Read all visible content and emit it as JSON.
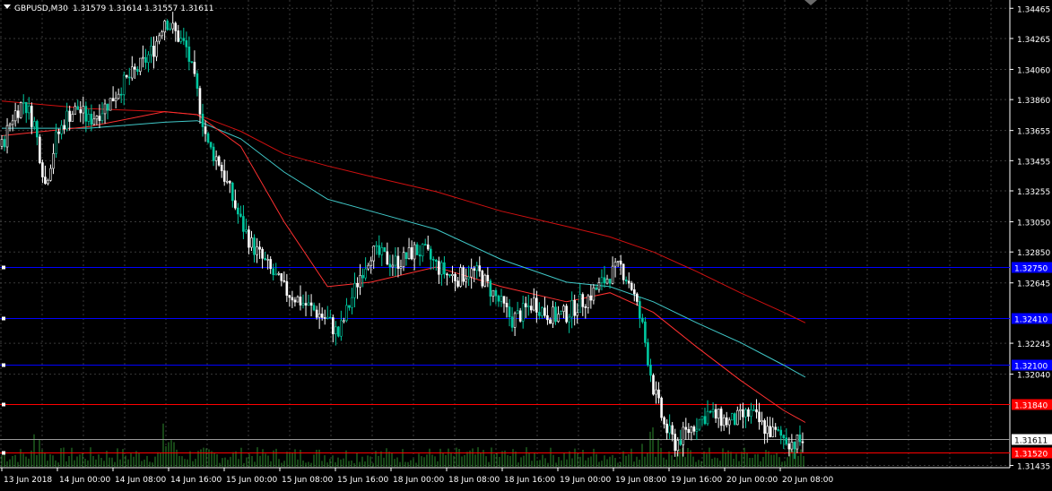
{
  "header": {
    "symbol": "GBPUSD,M30",
    "ohlc": "1.31579 1.31614 1.31557 1.31611"
  },
  "price_ticks": [
    "1.34465",
    "1.34265",
    "1.34060",
    "1.33860",
    "1.33655",
    "1.33455",
    "1.33255",
    "1.33050",
    "1.32850",
    "1.32645",
    "1.32245",
    "1.32040",
    "1.31435"
  ],
  "time_ticks": [
    "13 Jun 2018",
    "14 Jun 00:00",
    "14 Jun 08:00",
    "14 Jun 16:00",
    "15 Jun 00:00",
    "15 Jun 08:00",
    "15 Jun 16:00",
    "18 Jun 00:00",
    "18 Jun 08:00",
    "18 Jun 16:00",
    "19 Jun 00:00",
    "19 Jun 08:00",
    "19 Jun 16:00",
    "20 Jun 00:00",
    "20 Jun 08:00"
  ],
  "horizontal_lines": [
    {
      "price": 1.3275,
      "color": "#0000ff",
      "label": "1.32750"
    },
    {
      "price": 1.3241,
      "color": "#0000ff",
      "label": "1.32410"
    },
    {
      "price": 1.321,
      "color": "#0000ff",
      "label": "1.32100"
    },
    {
      "price": 1.3184,
      "color": "#ff0000",
      "label": "1.31840"
    },
    {
      "price": 1.3152,
      "color": "#ff0000",
      "label": "1.31520"
    }
  ],
  "current_price": {
    "price": 1.31611,
    "label": "1.31611"
  },
  "colors": {
    "background": "#000000",
    "grid": "#3a3a3a",
    "candle": "#ffffff",
    "candle_alt": "#00c8a0",
    "volume": "#2e8b2e",
    "ma_fast": "#ff3030",
    "ma_mid": "#40c8c8",
    "ma_slow": "#d01010",
    "axis_text": "#ffffff"
  },
  "chart_data": {
    "type": "candlestick",
    "title": "GBPUSD,M30",
    "y_range": [
      1.314,
      1.345
    ],
    "x_categories": [
      "13 Jun 2018",
      "14 Jun 00:00",
      "14 Jun 08:00",
      "14 Jun 16:00",
      "15 Jun 00:00",
      "15 Jun 08:00",
      "15 Jun 16:00",
      "18 Jun 00:00",
      "18 Jun 08:00",
      "18 Jun 16:00",
      "19 Jun 00:00",
      "19 Jun 08:00",
      "19 Jun 16:00",
      "20 Jun 00:00",
      "20 Jun 08:00"
    ],
    "close_path": [
      [
        0,
        1.3355
      ],
      [
        1,
        1.3375
      ],
      [
        2,
        1.3385
      ],
      [
        3,
        1.337
      ],
      [
        4,
        1.333
      ],
      [
        5,
        1.336
      ],
      [
        6,
        1.3375
      ],
      [
        7,
        1.338
      ],
      [
        8,
        1.3372
      ],
      [
        9,
        1.3378
      ],
      [
        10,
        1.3385
      ],
      [
        11,
        1.3395
      ],
      [
        12,
        1.3402
      ],
      [
        13,
        1.341
      ],
      [
        14,
        1.342
      ],
      [
        15,
        1.344
      ],
      [
        16,
        1.343
      ],
      [
        17,
        1.342
      ],
      [
        18,
        1.339
      ],
      [
        19,
        1.3355
      ],
      [
        20,
        1.3345
      ],
      [
        21,
        1.3325
      ],
      [
        22,
        1.3305
      ],
      [
        23,
        1.329
      ],
      [
        24,
        1.328
      ],
      [
        25,
        1.327
      ],
      [
        26,
        1.326
      ],
      [
        27,
        1.3255
      ],
      [
        28,
        1.325
      ],
      [
        29,
        1.3245
      ],
      [
        30,
        1.324
      ],
      [
        31,
        1.323
      ],
      [
        32,
        1.325
      ],
      [
        33,
        1.327
      ],
      [
        34,
        1.3285
      ],
      [
        35,
        1.3282
      ],
      [
        36,
        1.3278
      ],
      [
        37,
        1.328
      ],
      [
        38,
        1.3286
      ],
      [
        39,
        1.3284
      ],
      [
        40,
        1.3276
      ],
      [
        41,
        1.327
      ],
      [
        42,
        1.3268
      ],
      [
        43,
        1.3272
      ],
      [
        44,
        1.327
      ],
      [
        45,
        1.326
      ],
      [
        46,
        1.325
      ],
      [
        47,
        1.324
      ],
      [
        48,
        1.3245
      ],
      [
        49,
        1.3252
      ],
      [
        50,
        1.3245
      ],
      [
        51,
        1.3242
      ],
      [
        52,
        1.3244
      ],
      [
        53,
        1.325
      ],
      [
        54,
        1.3255
      ],
      [
        55,
        1.3262
      ],
      [
        56,
        1.327
      ],
      [
        57,
        1.3275
      ],
      [
        58,
        1.3262
      ],
      [
        59,
        1.3235
      ],
      [
        60,
        1.3195
      ],
      [
        61,
        1.317
      ],
      [
        62,
        1.3158
      ],
      [
        63,
        1.3165
      ],
      [
        64,
        1.3172
      ],
      [
        65,
        1.3178
      ],
      [
        66,
        1.3175
      ],
      [
        67,
        1.3172
      ],
      [
        68,
        1.3175
      ],
      [
        69,
        1.3178
      ],
      [
        70,
        1.317
      ],
      [
        71,
        1.3165
      ],
      [
        72,
        1.3162
      ],
      [
        73,
        1.3158
      ],
      [
        74,
        1.3161
      ]
    ],
    "ma_fast": [
      [
        0,
        1.3362
      ],
      [
        8,
        1.3368
      ],
      [
        15,
        1.3378
      ],
      [
        18,
        1.3376
      ],
      [
        22,
        1.3355
      ],
      [
        26,
        1.3305
      ],
      [
        30,
        1.3262
      ],
      [
        34,
        1.3265
      ],
      [
        40,
        1.3275
      ],
      [
        46,
        1.3262
      ],
      [
        52,
        1.3252
      ],
      [
        56,
        1.3258
      ],
      [
        60,
        1.3245
      ],
      [
        64,
        1.3222
      ],
      [
        68,
        1.32
      ],
      [
        72,
        1.318
      ],
      [
        74,
        1.3172
      ]
    ],
    "ma_mid": [
      [
        0,
        1.3367
      ],
      [
        8,
        1.3367
      ],
      [
        15,
        1.3371
      ],
      [
        18,
        1.3372
      ],
      [
        22,
        1.336
      ],
      [
        26,
        1.3338
      ],
      [
        30,
        1.332
      ],
      [
        34,
        1.3312
      ],
      [
        40,
        1.33
      ],
      [
        46,
        1.328
      ],
      [
        52,
        1.3265
      ],
      [
        56,
        1.3262
      ],
      [
        60,
        1.3252
      ],
      [
        64,
        1.3238
      ],
      [
        68,
        1.3225
      ],
      [
        72,
        1.321
      ],
      [
        74,
        1.3202
      ]
    ],
    "ma_slow": [
      [
        0,
        1.3385
      ],
      [
        8,
        1.338
      ],
      [
        15,
        1.3378
      ],
      [
        18,
        1.3376
      ],
      [
        22,
        1.3365
      ],
      [
        26,
        1.335
      ],
      [
        30,
        1.3342
      ],
      [
        34,
        1.3335
      ],
      [
        40,
        1.3325
      ],
      [
        46,
        1.3312
      ],
      [
        52,
        1.3302
      ],
      [
        56,
        1.3295
      ],
      [
        60,
        1.3285
      ],
      [
        64,
        1.3272
      ],
      [
        68,
        1.3258
      ],
      [
        72,
        1.3245
      ],
      [
        74,
        1.3238
      ]
    ]
  }
}
